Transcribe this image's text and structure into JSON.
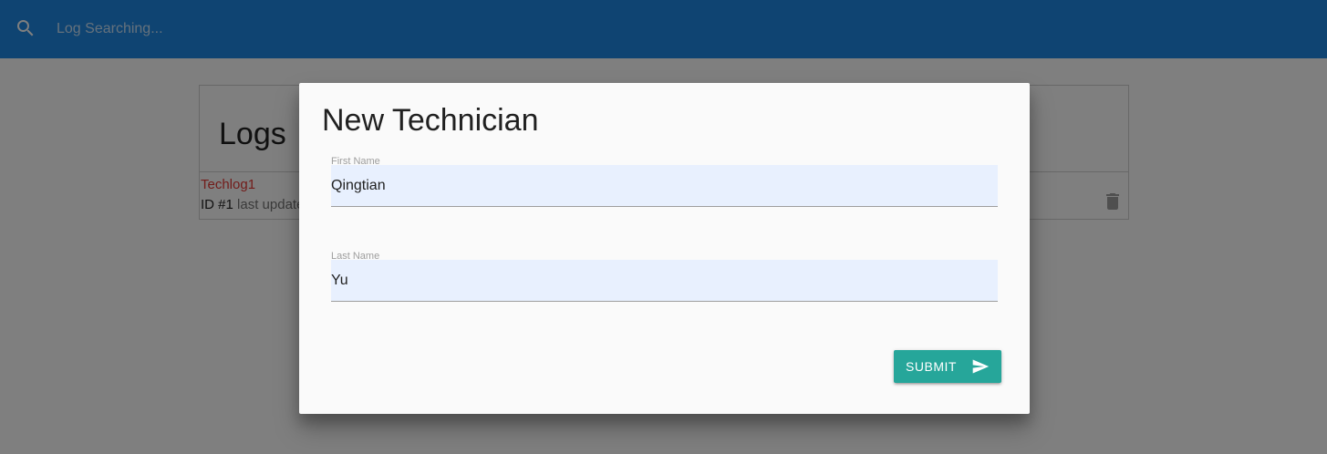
{
  "topbar": {
    "search_placeholder": "Log Searching...",
    "search_icon": "search-icon",
    "color": "#1e88e5"
  },
  "logs_card": {
    "title": "Logs",
    "items": [
      {
        "message": "Techlog1",
        "id_label": "ID #1",
        "meta_text": "last update",
        "delete_icon": "trash-icon"
      }
    ]
  },
  "modal": {
    "title": "New Technician",
    "first_name": {
      "label": "First Name",
      "value": "Qingtian"
    },
    "last_name": {
      "label": "Last Name",
      "value": "Yu"
    },
    "submit": {
      "label": "SUBMIT",
      "icon": "send-icon",
      "color": "#26a69a"
    }
  }
}
